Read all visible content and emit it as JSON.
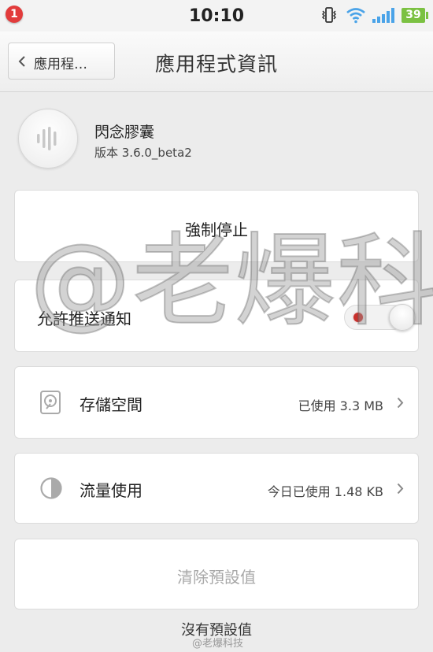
{
  "status_bar": {
    "notification_count": "1",
    "time": "10:10",
    "battery": "39",
    "icons": [
      "vibrate-icon",
      "wifi-icon",
      "signal-icon",
      "battery-icon"
    ],
    "colors": {
      "notification": "#e23b3b",
      "battery": "#7bc142",
      "wifi": "#4aa3e8"
    }
  },
  "header": {
    "back_label": "應用程…",
    "title": "應用程式資訊"
  },
  "app": {
    "name": "閃念膠囊",
    "version": "版本 3.6.0_beta2"
  },
  "actions": {
    "force_stop": "強制停止",
    "push_notifications": "允許推送通知",
    "push_enabled": false,
    "clear_defaults": "清除預設值"
  },
  "storage": {
    "label": "存儲空間",
    "value": "已使用 3.3 MB"
  },
  "data_usage": {
    "label": "流量使用",
    "value": "今日已使用 1.48 KB"
  },
  "defaults_note": "沒有預設值",
  "watermark": {
    "large": "@老爆科技",
    "small": "@老爆科技"
  }
}
